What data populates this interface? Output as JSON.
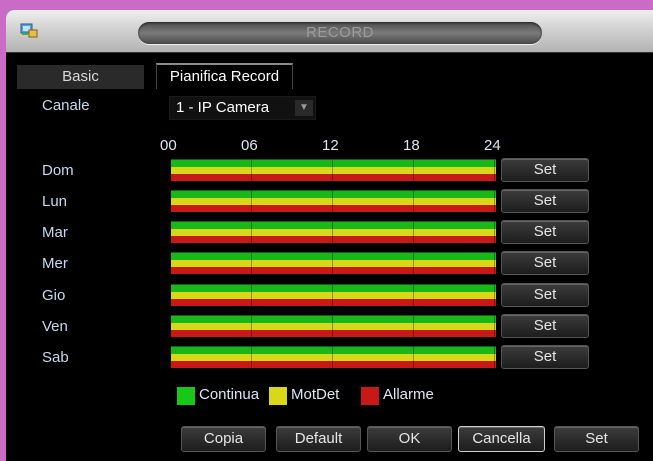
{
  "window": {
    "title": "RECORD"
  },
  "tabs": [
    {
      "label": "Basic"
    },
    {
      "label": "Pianifica Record"
    }
  ],
  "channel": {
    "label": "Canale",
    "value": "1 - IP Camera"
  },
  "hours": [
    "00",
    "06",
    "12",
    "18",
    "24"
  ],
  "days": [
    {
      "label": "Dom",
      "set_label": "Set"
    },
    {
      "label": "Lun",
      "set_label": "Set"
    },
    {
      "label": "Mar",
      "set_label": "Set"
    },
    {
      "label": "Mer",
      "set_label": "Set"
    },
    {
      "label": "Gio",
      "set_label": "Set"
    },
    {
      "label": "Ven",
      "set_label": "Set"
    },
    {
      "label": "Sab",
      "set_label": "Set"
    }
  ],
  "legend": [
    {
      "label": "Continua",
      "color": "#18c818"
    },
    {
      "label": "MotDet",
      "color": "#d8d818"
    },
    {
      "label": "Allarme",
      "color": "#c81818"
    }
  ],
  "buttons": {
    "copy": "Copia",
    "default": "Default",
    "ok": "OK",
    "cancel": "Cancella",
    "set": "Set"
  }
}
